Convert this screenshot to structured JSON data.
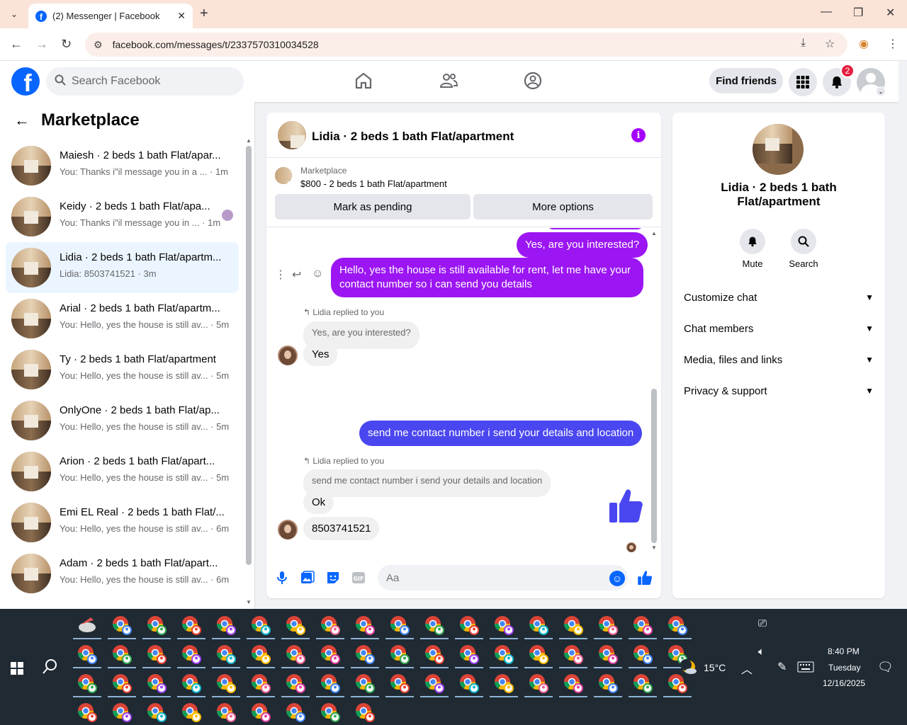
{
  "browser": {
    "tab_title": "(2) Messenger | Facebook",
    "url": "facebook.com/messages/t/2337570310034528"
  },
  "header": {
    "search_placeholder": "Search Facebook",
    "find_friends": "Find friends",
    "notification_count": "2"
  },
  "sidebar": {
    "title": "Marketplace",
    "conversations": [
      {
        "name": "Maiesh · 2 beds 1 bath Flat/apar...",
        "preview": "You: Thanks i\"il message you in a ... · 1m",
        "active": false
      },
      {
        "name": "Keidy · 2 beds 1 bath Flat/apa...",
        "preview": "You: Thanks i\"il message you in ... · 1m",
        "active": false
      },
      {
        "name": "Lidia · 2 beds 1 bath Flat/apartm...",
        "preview": "Lidia: 8503741521 · 3m",
        "active": true
      },
      {
        "name": "Arial · 2 beds 1 bath Flat/apartm...",
        "preview": "You: Hello, yes the house is still av... · 5m",
        "active": false
      },
      {
        "name": "Ty · 2 beds 1 bath Flat/apartment",
        "preview": "You: Hello, yes the house is still av... · 5m",
        "active": false
      },
      {
        "name": "OnlyOne · 2 beds 1 bath Flat/ap...",
        "preview": "You: Hello, yes the house is still av... · 5m",
        "active": false
      },
      {
        "name": "Arion · 2 beds 1 bath Flat/apart...",
        "preview": "You: Hello, yes the house is still av... · 5m",
        "active": false
      },
      {
        "name": "Emi EL Real · 2 beds 1 bath Flat/...",
        "preview": "You: Hello, yes the house is still av... · 6m",
        "active": false
      },
      {
        "name": "Adam · 2 beds 1 bath Flat/apart...",
        "preview": "You: Hello, yes the house is still av... · 6m",
        "active": false
      }
    ]
  },
  "chat": {
    "title": "Lidia · 2 beds 1 bath Flat/apartment",
    "marketplace_label": "Marketplace",
    "listing": "$800 - 2 beds 1 bath Flat/apartment",
    "mark_pending": "Mark as pending",
    "more_options": "More options",
    "messages": {
      "out1": "Yes, are you interested?",
      "out2": "Hello, yes the house is still available for rent, let me have your contact number so i can send you details",
      "replied_label": "Lidia replied to you",
      "quote1": "Yes, are you interested?",
      "in1": "Yes",
      "out3": "send me contact number i send your details and location",
      "quote2": "send me contact number i send your details and location",
      "in2": "Ok",
      "in3": "8503741521"
    },
    "composer_placeholder": "Aa"
  },
  "right_panel": {
    "title": "Lidia · 2 beds 1 bath Flat/apartment",
    "mute": "Mute",
    "search": "Search",
    "rows": [
      "Customize chat",
      "Chat members",
      "Media, files and links",
      "Privacy & support"
    ]
  },
  "taskbar": {
    "temperature": "15°C",
    "time": "8:40 PM",
    "day": "Tuesday",
    "date": "12/16/2025"
  },
  "colors": {
    "fb_blue": "#0866ff",
    "outgoing_purple": "#9b16f2",
    "outgoing_blue": "#4a47f0",
    "active_conv": "#ebf5ff",
    "badge_red": "#e41e3f"
  }
}
